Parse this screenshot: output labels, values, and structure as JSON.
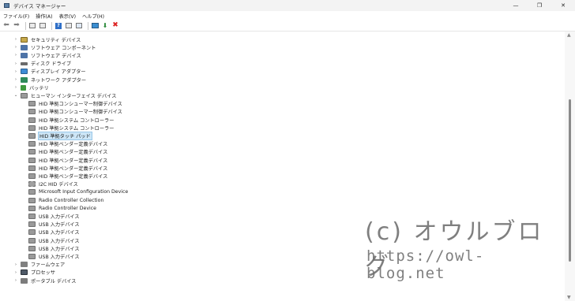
{
  "window": {
    "title": "デバイス マネージャー",
    "minimize_glyph": "—",
    "maximize_glyph": "❐",
    "close_glyph": "✕"
  },
  "menu": [
    {
      "label": "ファイル(F)"
    },
    {
      "label": "操作(A)"
    },
    {
      "label": "表示(V)"
    },
    {
      "label": "ヘルプ(H)"
    }
  ],
  "toolbar": {
    "back_glyph": "⬅",
    "forward_glyph": "➡",
    "help_glyph": "?",
    "enable_glyph": "⬇",
    "uninstall_glyph": "✖"
  },
  "tree": {
    "chevron_collapsed": "›",
    "chevron_expanded": "⌄",
    "rows": [
      {
        "label": "セキュリティ デバイス",
        "level": 0,
        "expanded": false,
        "icon": "security-device-icon"
      },
      {
        "label": "ソフトウェア コンポーネント",
        "level": 0,
        "expanded": false,
        "icon": "software-component-icon"
      },
      {
        "label": "ソフトウェア デバイス",
        "level": 0,
        "expanded": false,
        "icon": "software-device-icon"
      },
      {
        "label": "ディスク ドライブ",
        "level": 0,
        "expanded": false,
        "icon": "disk-drive-icon"
      },
      {
        "label": "ディスプレイ アダプター",
        "level": 0,
        "expanded": false,
        "icon": "display-adapter-icon"
      },
      {
        "label": "ネットワーク アダプター",
        "level": 0,
        "expanded": false,
        "icon": "network-adapter-icon"
      },
      {
        "label": "バッテリ",
        "level": 0,
        "expanded": false,
        "icon": "battery-icon"
      },
      {
        "label": "ヒューマン インターフェイス デバイス",
        "level": 0,
        "expanded": true,
        "icon": "hid-icon"
      },
      {
        "label": "HID 準拠コンシューマー制御デバイス",
        "level": 1,
        "icon": "hid-device-icon"
      },
      {
        "label": "HID 準拠コンシューマー制御デバイス",
        "level": 1,
        "icon": "hid-device-icon"
      },
      {
        "label": "HID 準拠システム コントローラー",
        "level": 1,
        "icon": "hid-device-icon"
      },
      {
        "label": "HID 準拠システム コントローラー",
        "level": 1,
        "icon": "hid-device-icon"
      },
      {
        "label": "HID 準拠タッチ パッド",
        "level": 1,
        "icon": "hid-device-icon",
        "selected": true
      },
      {
        "label": "HID 準拠ベンダー定義デバイス",
        "level": 1,
        "icon": "hid-device-icon"
      },
      {
        "label": "HID 準拠ベンダー定義デバイス",
        "level": 1,
        "icon": "hid-device-icon"
      },
      {
        "label": "HID 準拠ベンダー定義デバイス",
        "level": 1,
        "icon": "hid-device-icon"
      },
      {
        "label": "HID 準拠ベンダー定義デバイス",
        "level": 1,
        "icon": "hid-device-icon"
      },
      {
        "label": "HID 準拠ベンダー定義デバイス",
        "level": 1,
        "icon": "hid-device-icon"
      },
      {
        "label": "I2C HID デバイス",
        "level": 1,
        "icon": "i2c-device-icon"
      },
      {
        "label": "Microsoft Input Configuration Device",
        "level": 1,
        "icon": "hid-device-icon"
      },
      {
        "label": "Radio Controller Collection",
        "level": 1,
        "icon": "hid-device-icon"
      },
      {
        "label": "Radio Controller Device",
        "level": 1,
        "icon": "hid-device-icon"
      },
      {
        "label": "USB 入力デバイス",
        "level": 1,
        "icon": "usb-input-icon"
      },
      {
        "label": "USB 入力デバイス",
        "level": 1,
        "icon": "usb-input-icon"
      },
      {
        "label": "USB 入力デバイス",
        "level": 1,
        "icon": "usb-input-icon"
      },
      {
        "label": "USB 入力デバイス",
        "level": 1,
        "icon": "usb-input-icon"
      },
      {
        "label": "USB 入力デバイス",
        "level": 1,
        "icon": "usb-input-icon"
      },
      {
        "label": "USB 入力デバイス",
        "level": 1,
        "icon": "usb-input-icon"
      },
      {
        "label": "ファームウェア",
        "level": 0,
        "expanded": false,
        "icon": "firmware-icon"
      },
      {
        "label": "プロセッサ",
        "level": 0,
        "expanded": false,
        "icon": "processor-icon"
      },
      {
        "label": "ポータブル デバイス",
        "level": 0,
        "expanded": false,
        "icon": "portable-device-icon"
      }
    ]
  },
  "watermark": {
    "line1": "(c) オウルブログ",
    "line2": "https://owl-blog.net"
  }
}
